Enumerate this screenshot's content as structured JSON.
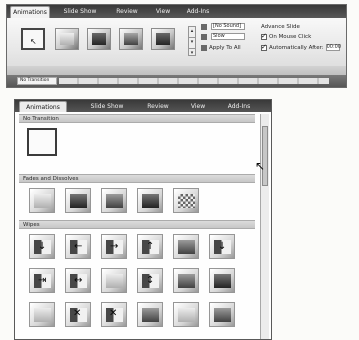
{
  "ribbon": {
    "tabs": [
      "Animations",
      "Slide Show",
      "Review",
      "View",
      "Add-Ins"
    ],
    "options": {
      "sound_label": "[No Sound]",
      "speed_label": "Slow",
      "apply_all_label": "Apply To All",
      "advance_label": "Advance Slide",
      "on_mouse_click_label": "On Mouse Click",
      "auto_after_label": "Automatically After:",
      "auto_after_value": "00:00"
    },
    "group_label": "",
    "lower_selected": "No Transition"
  },
  "panel": {
    "tabs": [
      "Animations",
      "Slide Show",
      "Review",
      "View",
      "Add-Ins"
    ],
    "sections": [
      "No Transition",
      "Fades and Dissolves",
      "Wipes"
    ]
  },
  "colors": {
    "ribbon_tab_bar": "#2f3e52",
    "ribbon_body": "#dbe4ee",
    "panel_bg": "#f7f8f8"
  }
}
